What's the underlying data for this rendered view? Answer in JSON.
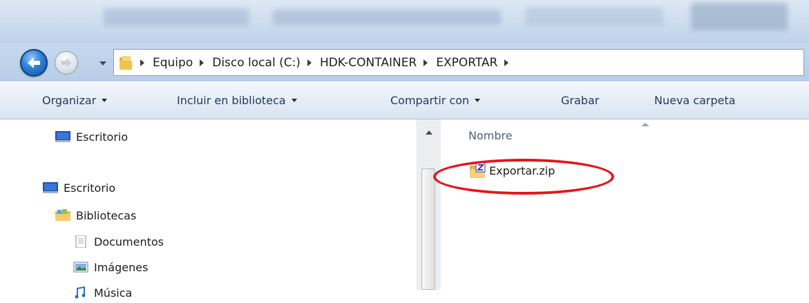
{
  "address_bar": {
    "breadcrumbs": [
      "Equipo",
      "Disco local (C:)",
      "HDK-CONTAINER",
      "EXPORTAR"
    ]
  },
  "commandbar": {
    "organize": "Organizar",
    "include_library": "Incluir en biblioteca",
    "share_with": "Compartir con",
    "burn": "Grabar",
    "new_folder": "Nueva carpeta"
  },
  "navigation": {
    "favorites_desktop": "Escritorio",
    "desktop": "Escritorio",
    "libraries": "Bibliotecas",
    "documents": "Documentos",
    "pictures": "Imágenes",
    "music": "Música"
  },
  "content": {
    "column_name": "Nombre",
    "files": [
      {
        "name": "Exportar.zip",
        "icon": "zip-folder-icon"
      }
    ]
  },
  "colors": {
    "highlight": "#e4151c",
    "command_text": "#1e395b"
  }
}
